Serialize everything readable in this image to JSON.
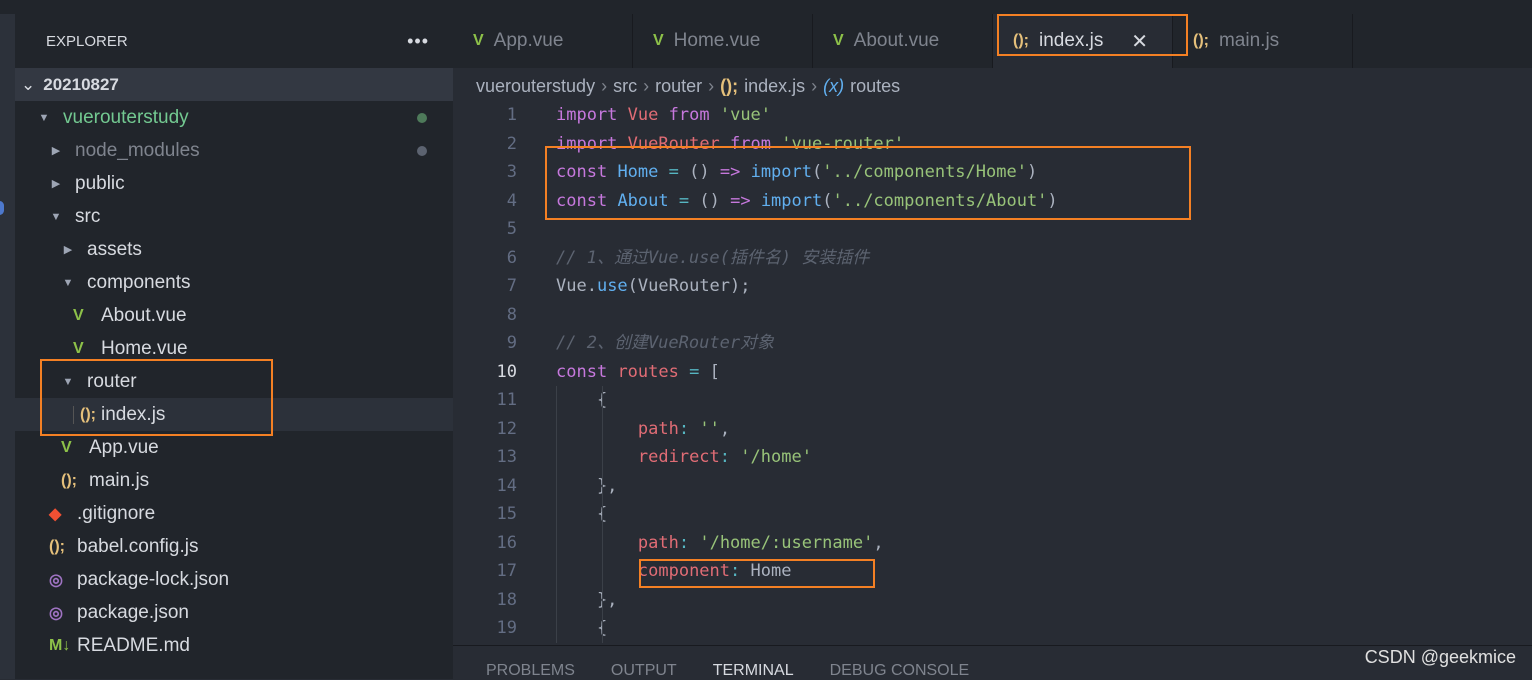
{
  "explorer": {
    "title": "EXPLORER",
    "more": "•••",
    "root": "20210827",
    "items": [
      {
        "label": "vuerouterstudy",
        "depth": 0,
        "twisty": "open",
        "color": "#73c991",
        "modified": "#4e7a5a"
      },
      {
        "label": "node_modules",
        "depth": 1,
        "twisty": "closed",
        "color": "#7f848e",
        "modified": "#5c6370"
      },
      {
        "label": "public",
        "depth": 1,
        "twisty": "closed"
      },
      {
        "label": "src",
        "depth": 1,
        "twisty": "open"
      },
      {
        "label": "assets",
        "depth": 2,
        "twisty": "closed"
      },
      {
        "label": "components",
        "depth": 2,
        "twisty": "open"
      },
      {
        "label": "About.vue",
        "depth": 3,
        "icon": "vue"
      },
      {
        "label": "Home.vue",
        "depth": 3,
        "icon": "vue"
      },
      {
        "label": "router",
        "depth": 2,
        "twisty": "open"
      },
      {
        "label": "index.js",
        "depth": 3,
        "icon": "js",
        "selected": true
      },
      {
        "label": "App.vue",
        "depth": 2,
        "icon": "vue"
      },
      {
        "label": "main.js",
        "depth": 2,
        "icon": "js"
      },
      {
        "label": ".gitignore",
        "depth": 1,
        "icon": "git"
      },
      {
        "label": "babel.config.js",
        "depth": 1,
        "icon": "js"
      },
      {
        "label": "package-lock.json",
        "depth": 1,
        "icon": "json"
      },
      {
        "label": "package.json",
        "depth": 1,
        "icon": "json"
      },
      {
        "label": "README.md",
        "depth": 1,
        "icon": "md"
      }
    ]
  },
  "tabs": [
    {
      "label": "App.vue",
      "icon": "vue"
    },
    {
      "label": "Home.vue",
      "icon": "vue"
    },
    {
      "label": "About.vue",
      "icon": "vue"
    },
    {
      "label": "index.js",
      "icon": "js",
      "active": true,
      "close": "✕"
    },
    {
      "label": "main.js",
      "icon": "js"
    }
  ],
  "breadcrumb": {
    "parts": [
      "vuerouterstudy",
      "src",
      "router",
      "index.js",
      "routes"
    ],
    "js_icon": "();",
    "var_icon": "(x)"
  },
  "icons": {
    "vue": "V",
    "js": "();",
    "git": "◆",
    "json": "◎",
    "md": "M↓"
  },
  "editor": {
    "current_line": 10,
    "lines": [
      [
        [
          "k",
          "import"
        ],
        [
          "p",
          " "
        ],
        [
          "v",
          "Vue"
        ],
        [
          "p",
          " "
        ],
        [
          "k",
          "from"
        ],
        [
          "p",
          " "
        ],
        [
          "s",
          "'vue'"
        ]
      ],
      [
        [
          "k",
          "import"
        ],
        [
          "p",
          " "
        ],
        [
          "v",
          "VueRouter"
        ],
        [
          "p",
          " "
        ],
        [
          "k",
          "from"
        ],
        [
          "p",
          " "
        ],
        [
          "s",
          "'vue-router'"
        ]
      ],
      [
        [
          "k",
          "const"
        ],
        [
          "p",
          " "
        ],
        [
          "f",
          "Home"
        ],
        [
          "p",
          " "
        ],
        [
          "o",
          "="
        ],
        [
          "p",
          " () "
        ],
        [
          "k",
          "=>"
        ],
        [
          "p",
          " "
        ],
        [
          "f",
          "import"
        ],
        [
          "p",
          "("
        ],
        [
          "s",
          "'../components/Home'"
        ],
        [
          "p",
          ")"
        ]
      ],
      [
        [
          "k",
          "const"
        ],
        [
          "p",
          " "
        ],
        [
          "f",
          "About"
        ],
        [
          "p",
          " "
        ],
        [
          "o",
          "="
        ],
        [
          "p",
          " () "
        ],
        [
          "k",
          "=>"
        ],
        [
          "p",
          " "
        ],
        [
          "f",
          "import"
        ],
        [
          "p",
          "("
        ],
        [
          "s",
          "'../components/About'"
        ],
        [
          "p",
          ")"
        ]
      ],
      [],
      [
        [
          "c",
          "// 1、通过Vue.use(插件名) 安装插件"
        ]
      ],
      [
        [
          "p",
          "Vue."
        ],
        [
          "f",
          "use"
        ],
        [
          "p",
          "(VueRouter);"
        ]
      ],
      [],
      [
        [
          "c",
          "// 2、创建VueRouter对象"
        ]
      ],
      [
        [
          "k",
          "const"
        ],
        [
          "p",
          " "
        ],
        [
          "v",
          "routes"
        ],
        [
          "p",
          " "
        ],
        [
          "o",
          "="
        ],
        [
          "p",
          " ["
        ]
      ],
      [
        [
          "p",
          "    {"
        ]
      ],
      [
        [
          "p",
          "        "
        ],
        [
          "v",
          "path"
        ],
        [
          "o",
          ":"
        ],
        [
          "p",
          " "
        ],
        [
          "s",
          "''"
        ],
        [
          "p",
          ","
        ]
      ],
      [
        [
          "p",
          "        "
        ],
        [
          "v",
          "redirect"
        ],
        [
          "o",
          ":"
        ],
        [
          "p",
          " "
        ],
        [
          "s",
          "'/home'"
        ]
      ],
      [
        [
          "p",
          "    },"
        ]
      ],
      [
        [
          "p",
          "    {"
        ]
      ],
      [
        [
          "p",
          "        "
        ],
        [
          "v",
          "path"
        ],
        [
          "o",
          ":"
        ],
        [
          "p",
          " "
        ],
        [
          "s",
          "'/home/:username'"
        ],
        [
          "p",
          ","
        ]
      ],
      [
        [
          "p",
          "        "
        ],
        [
          "v",
          "component"
        ],
        [
          "o",
          ":"
        ],
        [
          "p",
          " Home"
        ]
      ],
      [
        [
          "p",
          "    },"
        ]
      ],
      [
        [
          "p",
          "    {"
        ]
      ]
    ]
  },
  "panel": {
    "tabs": [
      "PROBLEMS",
      "OUTPUT",
      "TERMINAL",
      "DEBUG CONSOLE"
    ],
    "active": "TERMINAL"
  },
  "watermark": "CSDN @geekmice",
  "colors": {
    "highlight": "#f48024",
    "keyword": "#c678dd",
    "variable": "#e06c75",
    "string": "#98c379",
    "function": "#61afef"
  }
}
